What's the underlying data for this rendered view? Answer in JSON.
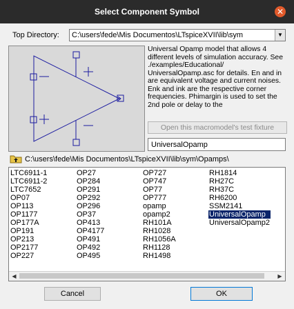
{
  "window": {
    "title": "Select Component Symbol",
    "close_glyph": "✕"
  },
  "top_directory": {
    "label": "Top Directory:",
    "value": "C:\\users\\fede\\Mis Documentos\\LTspiceXVII\\lib\\sym",
    "arrow_glyph": "▼"
  },
  "preview": {
    "symbol_name": "opamp-symbol"
  },
  "description": "Universal Opamp model that allows 4 different levels of simulation accuracy. See ./examples/Educational/ UniversalOpamp.asc for details.  En and in are equivalent voltage and current noises.  Enk and ink are the respective corner frequencies.  Phimargin is used to set the 2nd pole or delay to the",
  "fixture_button": "Open this macromodel's test fixture",
  "selected_name": "UniversalOpamp",
  "current_path": "C:\\users\\fede\\Mis Documentos\\LTspiceXVII\\lib\\sym\\Opamps\\",
  "list": {
    "col1": [
      "LTC6911-1",
      "LTC6911-2",
      "LTC7652",
      "OP07",
      "OP113",
      "OP1177",
      "OP177A",
      "OP191",
      "OP213",
      "OP2177",
      "OP227"
    ],
    "col2": [
      "OP27",
      "OP284",
      "OP291",
      "OP292",
      "OP296",
      "OP37",
      "OP413",
      "OP4177",
      "OP491",
      "OP492",
      "OP495"
    ],
    "col3": [
      "OP727",
      "OP747",
      "OP77",
      "OP777",
      "opamp",
      "opamp2",
      "RH101A",
      "RH1028",
      "RH1056A",
      "RH1128",
      "RH1498"
    ],
    "col4": [
      "RH1814",
      "RH27C",
      "RH37C",
      "RH6200",
      "SSM2141",
      "UniversalOpamp",
      "UniversalOpamp2"
    ],
    "selected": "UniversalOpamp"
  },
  "scrollbar": {
    "left_glyph": "◀",
    "right_glyph": "▶"
  },
  "buttons": {
    "cancel": "Cancel",
    "ok": "OK"
  },
  "colors": {
    "selection": "#0a246a",
    "symbol_stroke": "#1a1aa0",
    "titlebar": "#2b2b2b",
    "close": "#e15a2b"
  }
}
